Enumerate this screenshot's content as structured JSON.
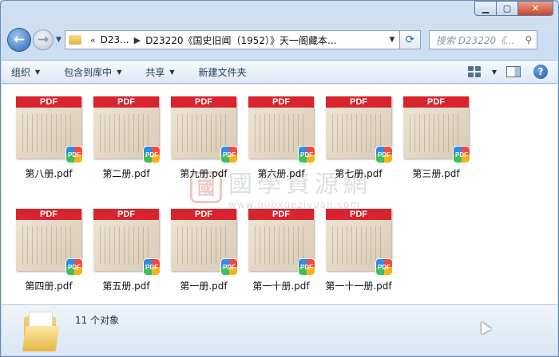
{
  "window": {
    "controls": {
      "minimize_icon": "minimize-icon",
      "maximize_icon": "maximize-icon",
      "close_icon": "close-icon"
    }
  },
  "nav": {
    "back_glyph": "←",
    "forward_glyph": "→",
    "address": {
      "crumb_root": "D23...",
      "crumb_sep_1": "«",
      "crumb_sep_2": "▶",
      "crumb_current": "D23220《国史旧闻（1952）》天一阁藏本..."
    },
    "search_placeholder": "搜索 D23220《...",
    "search_glyph": "⚲",
    "refresh_glyph": "⟳"
  },
  "toolbar": {
    "organize": "组织",
    "include_library": "包含到库中",
    "share": "共享",
    "new_folder": "新建文件夹"
  },
  "files": [
    {
      "name": "第八册.pdf"
    },
    {
      "name": "第二册.pdf"
    },
    {
      "name": "第九册.pdf"
    },
    {
      "name": "第六册.pdf"
    },
    {
      "name": "第七册.pdf"
    },
    {
      "name": "第三册.pdf"
    },
    {
      "name": "第四册.pdf"
    },
    {
      "name": "第五册.pdf"
    },
    {
      "name": "第一册.pdf"
    },
    {
      "name": "第一十册.pdf"
    },
    {
      "name": "第一十一册.pdf"
    }
  ],
  "thumb_label": "PDF",
  "badge_label": "PDF",
  "watermark": {
    "logo": "國",
    "cn": "國學資源網",
    "url": "www.guoxueziyuan.com"
  },
  "status": {
    "count": "11 个对象"
  },
  "colors": {
    "pdf_red": "#d9232e",
    "window_blue": "#c9dcef"
  }
}
